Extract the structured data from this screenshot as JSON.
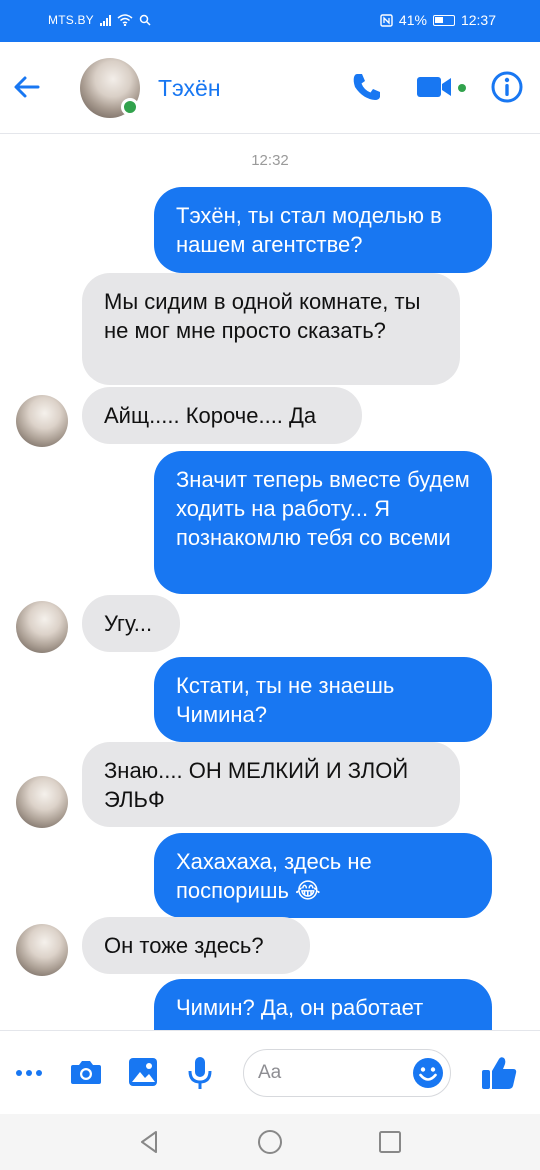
{
  "status_bar": {
    "carrier": "MTS.BY",
    "battery": "41%",
    "time": "12:37"
  },
  "header": {
    "contact_name": "Тэхён",
    "icons": [
      "back-arrow-icon",
      "phone-icon",
      "video-camera-icon",
      "info-icon"
    ],
    "online": true
  },
  "chat": {
    "timestamp": "12:32",
    "messages": [
      {
        "from": "me",
        "text": "Тэхён, ты стал моделью в нашем агентстве?"
      },
      {
        "from": "them",
        "text": "Мы сидим в одной комнате, ты не мог мне просто сказать?"
      },
      {
        "from": "them",
        "text": "Айщ..... Короче.... Да"
      },
      {
        "from": "me",
        "text": "Значит теперь вместе будем ходить на работу... Я познакомлю тебя со всеми"
      },
      {
        "from": "them",
        "text": "Угу..."
      },
      {
        "from": "me",
        "text": "Кстати, ты не знаешь Чимина?"
      },
      {
        "from": "them",
        "text": "Знаю.... ОН МЕЛКИЙ И ЗЛОЙ ЭЛЬФ"
      },
      {
        "from": "me",
        "text": "Хахахаха, здесь не поспоришь 😂"
      },
      {
        "from": "them",
        "text": "Он тоже здесь?"
      },
      {
        "from": "me",
        "text": "Чимин? Да, он работает"
      }
    ]
  },
  "composer": {
    "placeholder": "Aa",
    "icons": [
      "more-icon",
      "camera-icon",
      "image-icon",
      "microphone-icon",
      "emoji-icon",
      "like-icon"
    ]
  },
  "colors": {
    "brand": "#1877f2",
    "incoming_bubble": "#e6e6e8",
    "online": "#31a24c"
  }
}
